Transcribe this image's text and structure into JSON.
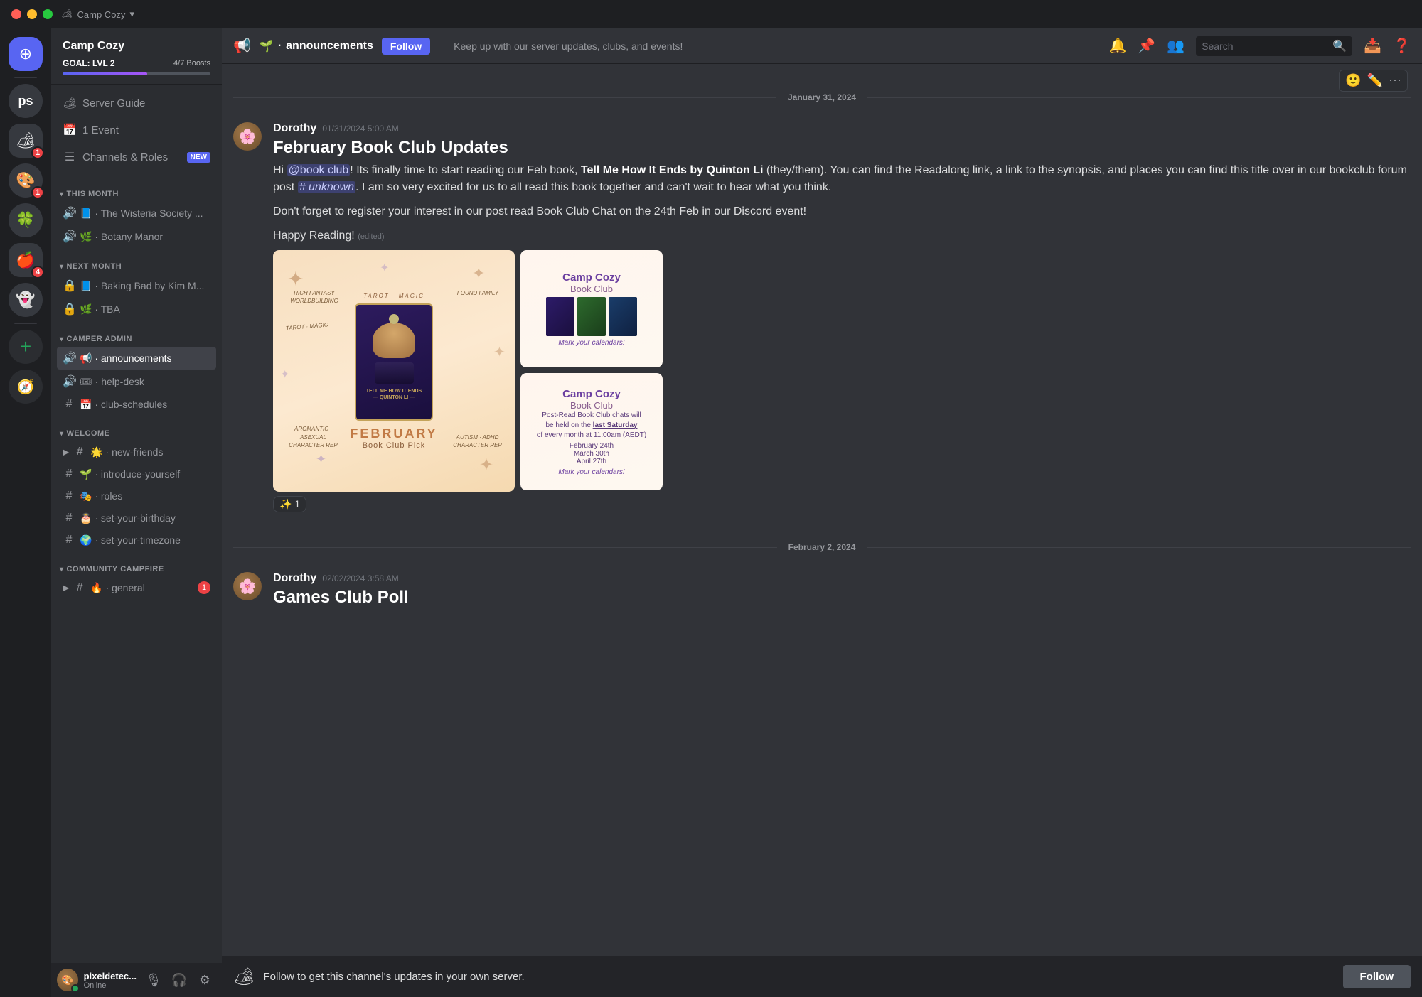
{
  "titlebar": {
    "server_name": "Camp Cozy",
    "dropdown_icon": "▾"
  },
  "sidebar": {
    "boost_goal": "GOAL: LVL 2",
    "boost_count": "4/7 Boosts",
    "boost_chevron": "›",
    "nav_items": [
      {
        "icon": "🏕",
        "label": "Server Guide"
      },
      {
        "icon": "📅",
        "label": "1 Event"
      },
      {
        "icon": "☰",
        "label": "Channels & Roles",
        "badge": "NEW"
      }
    ],
    "sections": [
      {
        "title": "THIS MONTH",
        "channels": [
          {
            "icon": "🔊",
            "prefix": "📘",
            "name": "The Wisteria Society ...",
            "locked": false
          },
          {
            "icon": "🔊",
            "prefix": "🌿",
            "name": "Botany Manor",
            "locked": false
          }
        ]
      },
      {
        "title": "NEXT MONTH",
        "channels": [
          {
            "icon": "#",
            "prefix": "📘",
            "name": "Baking Bad by Kim M...",
            "locked": true
          },
          {
            "icon": "#",
            "prefix": "🌿",
            "name": "TBA",
            "locked": true
          }
        ]
      },
      {
        "title": "CAMPER ADMIN",
        "channels": [
          {
            "icon": "🔊",
            "prefix": "📢",
            "name": "announcements",
            "locked": false,
            "active": true,
            "add_icon": true
          },
          {
            "icon": "🔊",
            "prefix": "🎟",
            "name": "help-desk",
            "locked": false
          },
          {
            "icon": "#",
            "prefix": "📅",
            "name": "club-schedules",
            "locked": false
          }
        ]
      },
      {
        "title": "WELCOME",
        "channels": [
          {
            "icon": "#",
            "prefix": "🌟",
            "name": "new-friends",
            "locked": false,
            "expanded": true
          },
          {
            "icon": "#",
            "prefix": "🌱",
            "name": "introduce-yourself",
            "locked": false
          },
          {
            "icon": "#",
            "prefix": "🎭",
            "name": "roles",
            "locked": false
          },
          {
            "icon": "#",
            "prefix": "🎂",
            "name": "set-your-birthday",
            "locked": false
          },
          {
            "icon": "#",
            "prefix": "🌍",
            "name": "set-your-timezone",
            "locked": false
          }
        ]
      },
      {
        "title": "COMMUNITY CAMPFIRE",
        "channels": [
          {
            "icon": "#",
            "prefix": "🔥",
            "name": "general",
            "locked": false,
            "expanded": true,
            "notification": "1"
          }
        ]
      }
    ],
    "user": {
      "name": "pixeldetec...",
      "status": "Online"
    }
  },
  "topbar": {
    "channel_emoji": "📢",
    "channel_dot": "·",
    "channel_name": "announcements",
    "follow_label": "Follow",
    "description": "Keep up with our server updates, clubs, and events!",
    "search_placeholder": "Search"
  },
  "messages": [
    {
      "date_separator": "January 31, 2024",
      "author": "Dorothy",
      "timestamp": "01/31/2024 5:00 AM",
      "title": "February Book Club Updates",
      "body_before_mention": "Hi ",
      "mention": "@book club",
      "body_after_mention": "! Its finally time to start reading our Feb book, ",
      "bold_text": "Tell Me How It Ends by Quinton Li",
      "body_italic": " (they/them)",
      "body_mid": ". You can find the Readalong link, a link to the synopsis, and places you can find this title over in our bookclub forum post ",
      "hashtag_mention": "# unknown",
      "body_end": ". I am so very excited for us to all read this book together and can't wait to hear what you think.",
      "paragraph2": "Don't forget to register your interest in our post read Book Club Chat on the 24th Feb in our Discord event!",
      "happy_reading": "Happy Reading!",
      "edited": "(edited)",
      "reaction": "✨ 1",
      "images": {
        "tarot_label_top": "TAROT · MAGIC",
        "rich_fantasy": "RICH FANTASY\nWORLDBUILDING",
        "found_family": "FOUND FAMILY",
        "aromantic": "AROMANTIC · ASEXUAL\nCHARACTER REP",
        "autism": "AUTISM · ADHD\nCHARACTER REP",
        "card_title": "TELL ME HOW IT ENDS\n— QUINTON LI —",
        "february": "FEBRUARY",
        "book_club_pick": "Book Club Pick",
        "camp_cozy_1": "Camp Cozy",
        "book_club_1": "Book Club",
        "mark_cal_1": "Mark your calendars!",
        "camp_cozy_2": "Camp Cozy",
        "book_club_2": "Book Club",
        "post_read": "Post-Read Book Club chats will\nbe held on the",
        "last_saturday": "last Saturday",
        "of_every": "of every month at 11:00am (AEDT)",
        "dates": "February 24th\nMarch 30th\nApril 27th",
        "mark_cal_2": "Mark your calendars!"
      }
    },
    {
      "date_separator": "February 2, 2024",
      "author": "Dorothy",
      "timestamp": "02/02/2024 3:58 AM",
      "title": "Games Club Poll"
    }
  ],
  "bottom_bar": {
    "text": "Follow to get this channel's updates in your own server.",
    "follow_label": "Follow"
  }
}
